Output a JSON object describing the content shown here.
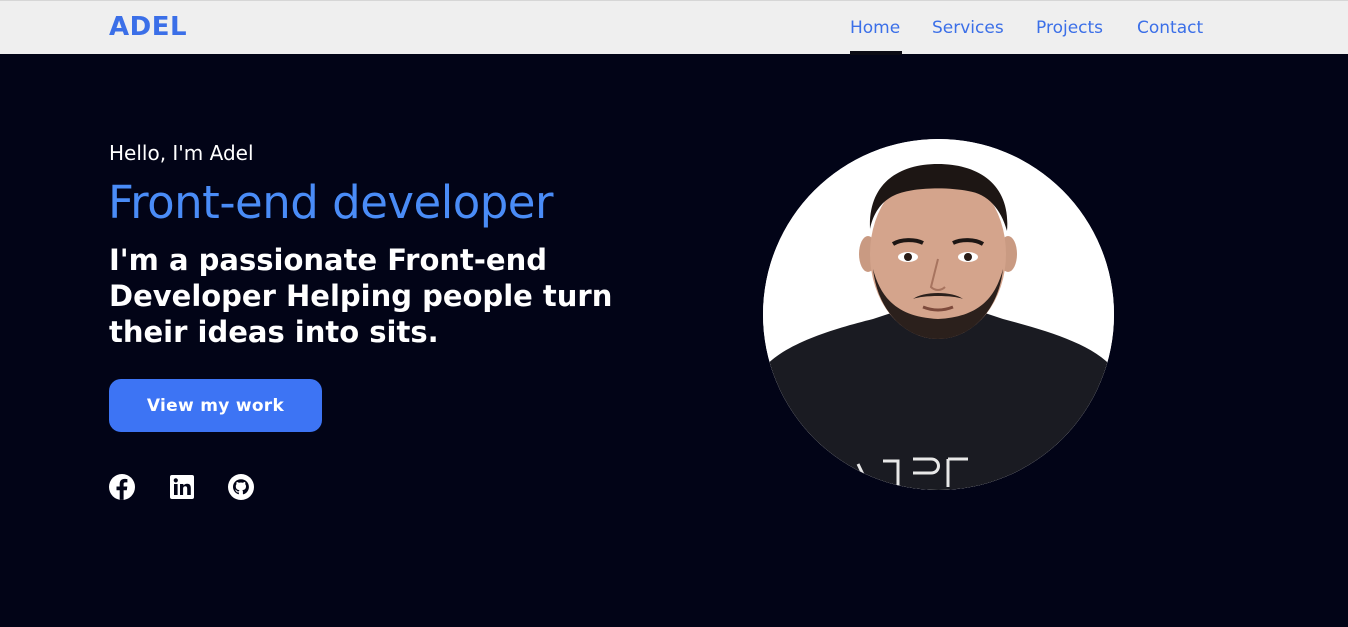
{
  "header": {
    "logo": "ADEL",
    "nav": [
      {
        "label": "Home",
        "active": true
      },
      {
        "label": "Services"
      },
      {
        "label": "Projects"
      },
      {
        "label": "Contact"
      }
    ]
  },
  "hero": {
    "greeting": "Hello, I'm Adel",
    "role": "Front-end developer",
    "pitch": "I'm a passionate Front-end Developer Helping people turn their ideas into sits.",
    "cta_label": "View my work",
    "socials": [
      "facebook-icon",
      "linkedin-icon",
      "github-icon"
    ]
  },
  "colors": {
    "background": "#020417",
    "accent": "#3d74f4",
    "role_text": "#4a8cf7",
    "navbar": "#efefef"
  }
}
